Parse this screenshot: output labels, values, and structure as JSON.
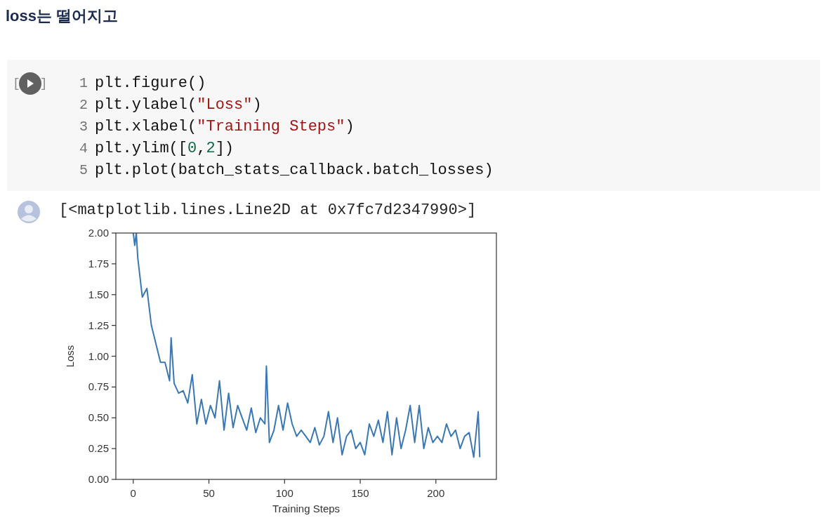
{
  "heading": "loss는 떨어지고",
  "code_cell": {
    "prompt_brackets": [
      "[",
      "]"
    ],
    "lines": [
      {
        "number": "1",
        "tokens": [
          {
            "kind": "plain",
            "text": "plt.figure()"
          }
        ]
      },
      {
        "number": "2",
        "tokens": [
          {
            "kind": "plain",
            "text": "plt.ylabel("
          },
          {
            "kind": "string",
            "text": "\"Loss\""
          },
          {
            "kind": "plain",
            "text": ")"
          }
        ]
      },
      {
        "number": "3",
        "tokens": [
          {
            "kind": "plain",
            "text": "plt.xlabel("
          },
          {
            "kind": "string",
            "text": "\"Training Steps\""
          },
          {
            "kind": "plain",
            "text": ")"
          }
        ]
      },
      {
        "number": "4",
        "tokens": [
          {
            "kind": "plain",
            "text": "plt.ylim(["
          },
          {
            "kind": "number",
            "text": "0"
          },
          {
            "kind": "plain",
            "text": ","
          },
          {
            "kind": "number",
            "text": "2"
          },
          {
            "kind": "plain",
            "text": "])"
          }
        ]
      },
      {
        "number": "5",
        "tokens": [
          {
            "kind": "plain",
            "text": "plt.plot(batch_stats_callback.batch_losses)"
          }
        ]
      }
    ]
  },
  "output": {
    "text": "[<matplotlib.lines.Line2D at 0x7fc7d2347990>]",
    "chart_data": {
      "type": "line",
      "xlabel": "Training Steps",
      "ylabel": "Loss",
      "x": [
        0,
        1,
        2,
        3,
        6,
        9,
        12,
        15,
        18,
        21,
        24,
        25,
        27,
        30,
        33,
        36,
        39,
        42,
        45,
        48,
        51,
        54,
        57,
        60,
        63,
        66,
        69,
        72,
        75,
        78,
        81,
        84,
        87,
        88,
        90,
        93,
        96,
        99,
        102,
        105,
        108,
        111,
        114,
        117,
        120,
        123,
        126,
        129,
        132,
        135,
        138,
        141,
        144,
        147,
        150,
        153,
        156,
        159,
        162,
        165,
        168,
        171,
        174,
        177,
        180,
        183,
        186,
        189,
        192,
        195,
        198,
        201,
        204,
        207,
        210,
        213,
        216,
        219,
        222,
        225,
        228,
        229
      ],
      "series": [
        {
          "color": "#3a78b4",
          "values": [
            2.0,
            1.9,
            2.0,
            1.8,
            1.48,
            1.55,
            1.25,
            1.1,
            0.95,
            0.95,
            0.8,
            1.15,
            0.78,
            0.7,
            0.72,
            0.62,
            0.85,
            0.45,
            0.65,
            0.45,
            0.6,
            0.5,
            0.8,
            0.4,
            0.7,
            0.42,
            0.6,
            0.5,
            0.4,
            0.58,
            0.38,
            0.5,
            0.45,
            0.92,
            0.3,
            0.4,
            0.6,
            0.4,
            0.62,
            0.45,
            0.35,
            0.4,
            0.35,
            0.3,
            0.42,
            0.28,
            0.35,
            0.55,
            0.3,
            0.5,
            0.2,
            0.35,
            0.4,
            0.25,
            0.3,
            0.2,
            0.45,
            0.35,
            0.48,
            0.3,
            0.55,
            0.2,
            0.5,
            0.25,
            0.4,
            0.6,
            0.3,
            0.6,
            0.25,
            0.42,
            0.3,
            0.35,
            0.3,
            0.45,
            0.35,
            0.4,
            0.25,
            0.35,
            0.38,
            0.18,
            0.55,
            0.18
          ]
        }
      ],
      "xlim": [
        -11.5,
        240
      ],
      "ylim": [
        0,
        2
      ],
      "xticks": [
        0,
        50,
        100,
        150,
        200
      ],
      "yticks": [
        {
          "value": 0,
          "label": "0.00"
        },
        {
          "value": 0.25,
          "label": "0.25"
        },
        {
          "value": 0.5,
          "label": "0.50"
        },
        {
          "value": 0.75,
          "label": "0.75"
        },
        {
          "value": 1,
          "label": "1.00"
        },
        {
          "value": 1.25,
          "label": "1.25"
        },
        {
          "value": 1.5,
          "label": "1.50"
        },
        {
          "value": 1.75,
          "label": "1.75"
        },
        {
          "value": 2,
          "label": "2.00"
        }
      ]
    }
  }
}
